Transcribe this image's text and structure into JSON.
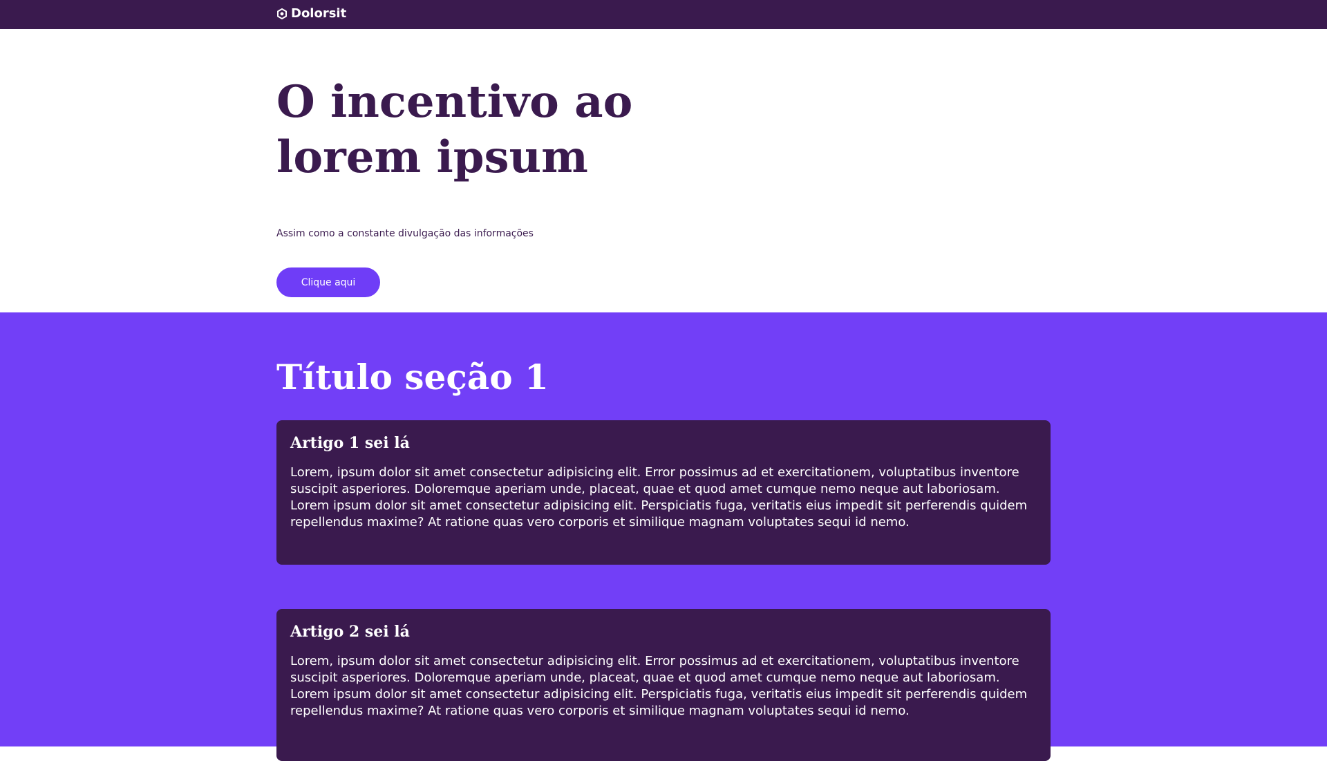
{
  "header": {
    "brand_name": "Dolorsit",
    "brand_icon": "gear-hexagon-icon",
    "background_color": "#3a1a4e"
  },
  "hero": {
    "title": "O incentivo ao lorem ipsum",
    "subtitle": "Assim como a constante divulgação das informações",
    "button_label": "Clique aqui",
    "button_color": "#6f3df7"
  },
  "section1": {
    "title": "Título seção 1",
    "background_color": "#723ff7",
    "articles": [
      {
        "title": "Artigo 1 sei lá",
        "body": "Lorem, ipsum dolor sit amet consectetur adipisicing elit. Error possimus ad et exercitationem, voluptatibus inventore suscipit asperiores. Doloremque aperiam unde, placeat, quae et quod amet cumque nemo neque aut laboriosam. Lorem ipsum dolor sit amet consectetur adipisicing elit. Perspiciatis fuga, veritatis eius impedit sit perferendis quidem repellendus maxime? At ratione quas vero corporis et similique magnam voluptates sequi id nemo."
      },
      {
        "title": "Artigo 2 sei lá",
        "body": "Lorem, ipsum dolor sit amet consectetur adipisicing elit. Error possimus ad et exercitationem, voluptatibus inventore suscipit asperiores. Doloremque aperiam unde, placeat, quae et quod amet cumque nemo neque aut laboriosam. Lorem ipsum dolor sit amet consectetur adipisicing elit. Perspiciatis fuga, veritatis eius impedit sit perferendis quidem repellendus maxime? At ratione quas vero corporis et similique magnam voluptates sequi id nemo."
      }
    ]
  }
}
